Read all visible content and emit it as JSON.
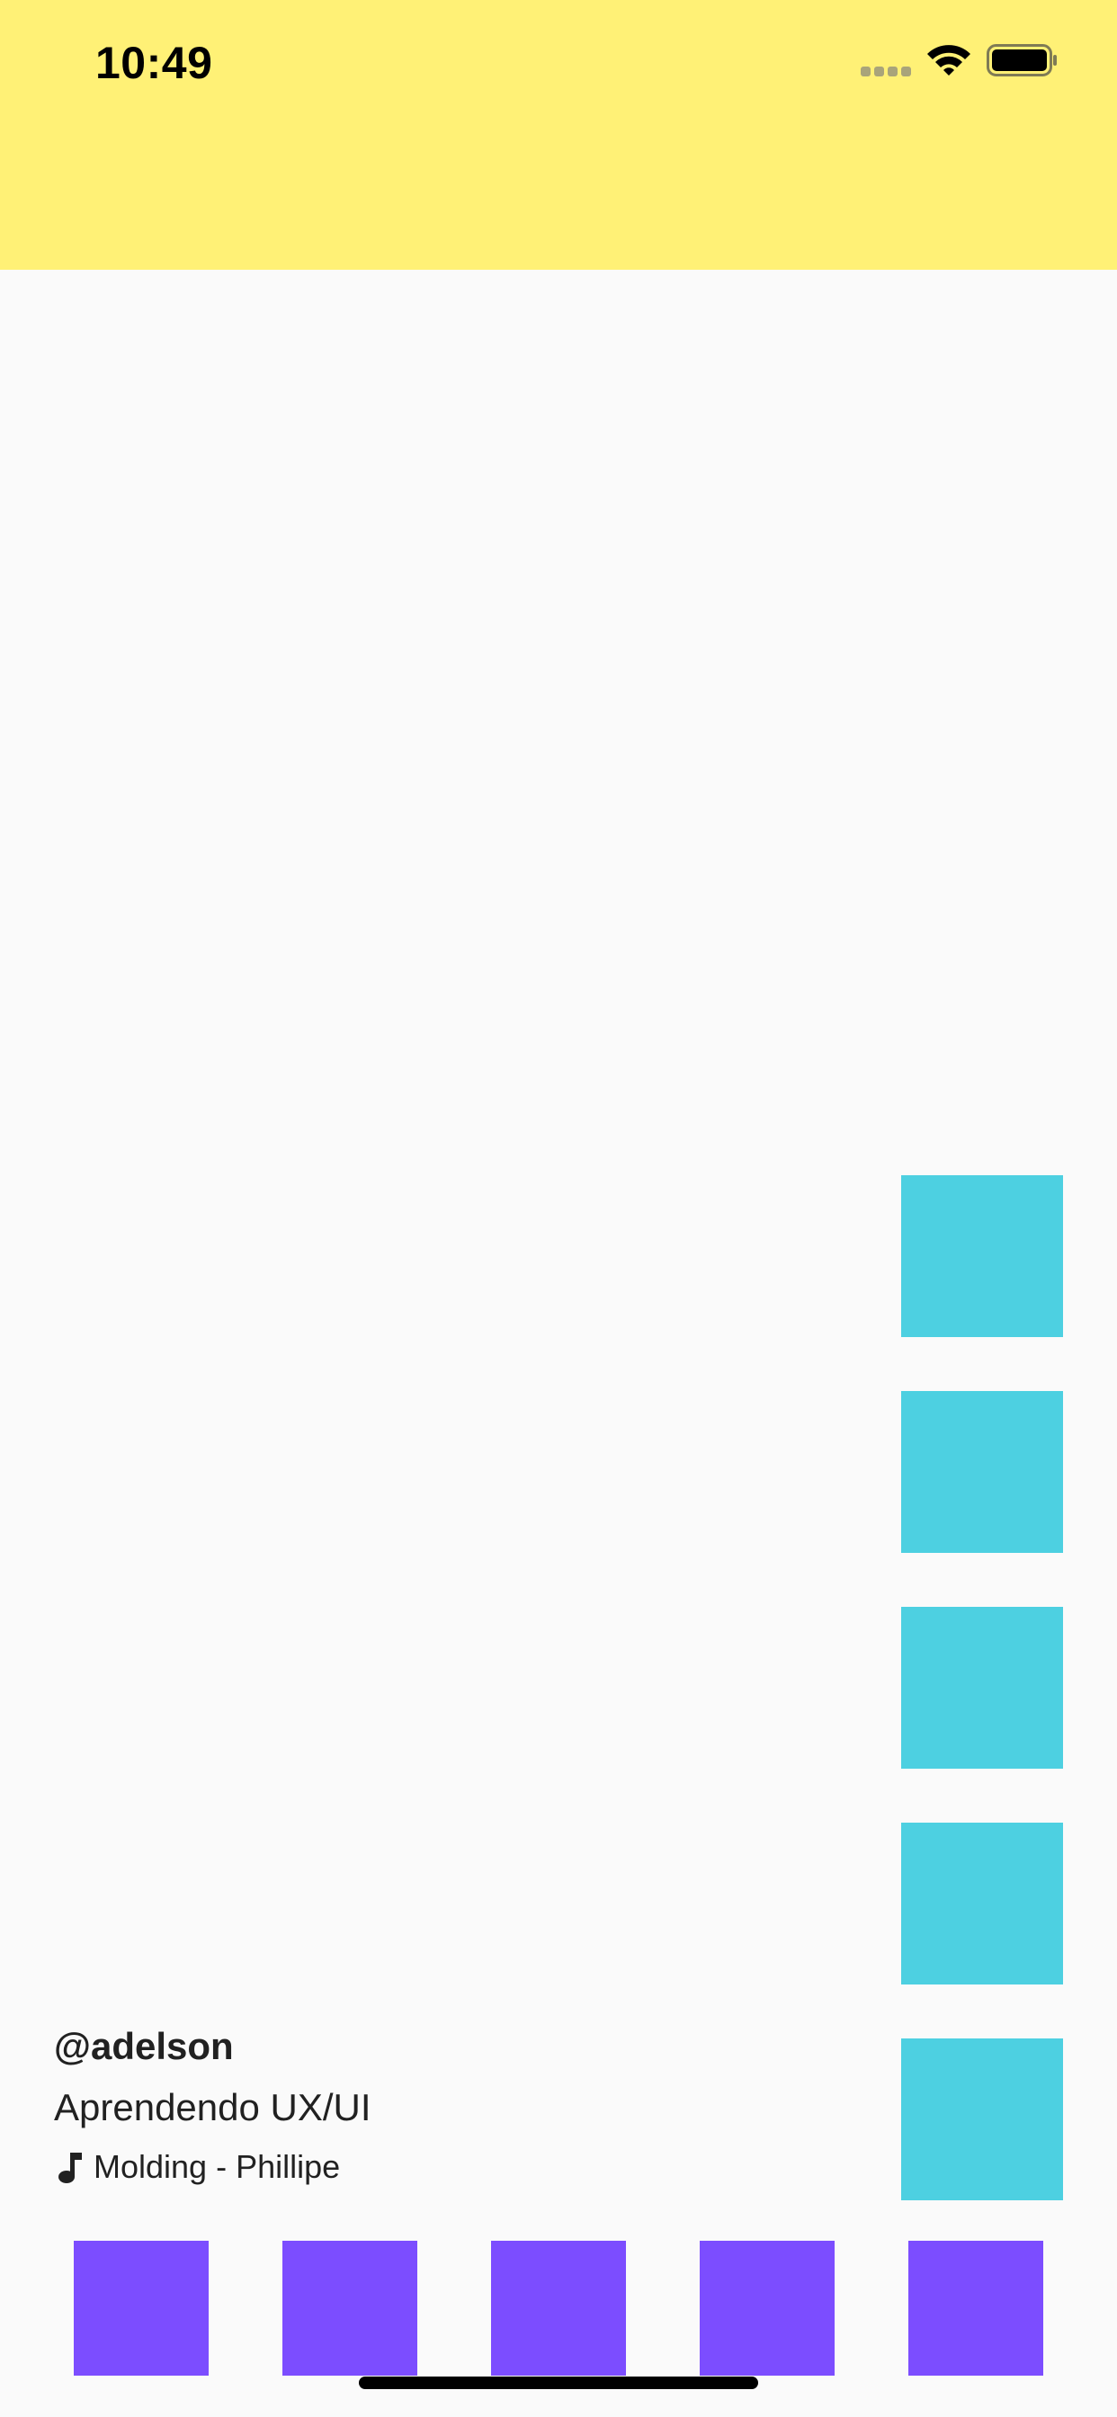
{
  "status_bar": {
    "time": "10:49",
    "icons": [
      "cellular-signal-icon",
      "wifi-icon",
      "battery-icon"
    ]
  },
  "colors": {
    "top_bar": "#fff176",
    "background": "#fafafa",
    "action_buttons": "#4dd0e1",
    "nav_buttons": "#7c4dff",
    "text": "#212121"
  },
  "video": {
    "username": "@adelson",
    "caption": "Aprendendo UX/UI",
    "music": {
      "icon": "music-note-icon",
      "label": "Molding - Phillipe"
    }
  },
  "action_buttons": [
    "action-button-1",
    "action-button-2",
    "action-button-3",
    "action-button-4",
    "action-button-5"
  ],
  "bottom_nav": [
    "nav-button-1",
    "nav-button-2",
    "nav-button-3",
    "nav-button-4",
    "nav-button-5"
  ]
}
